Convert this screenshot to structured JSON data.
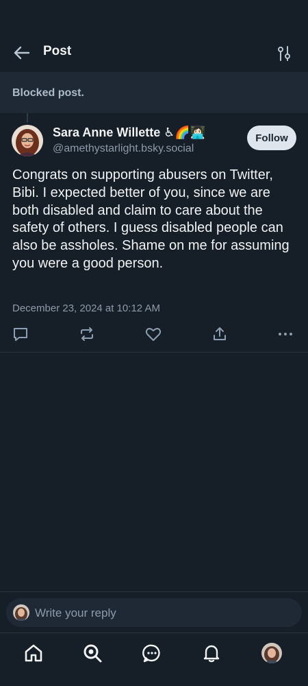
{
  "header": {
    "title": "Post"
  },
  "blocked": {
    "text": "Blocked post."
  },
  "post": {
    "author_name": "Sara Anne Willette ♿🌈👩🏻‍💻",
    "author_handle": "@amethystarlight.bsky.social",
    "follow_label": "Follow",
    "text": "Congrats on supporting abusers on Twitter, Bibi. I expected better of you, since we are both disabled and claim to care about the safety of others. I guess disabled people can also be assholes. Shame on me for assuming you were a good person.",
    "date": "December 23, 2024 at 10:12 AM"
  },
  "actions": {
    "icons": [
      "reply-icon",
      "repost-icon",
      "like-icon",
      "share-icon",
      "more-icon"
    ]
  },
  "reply": {
    "placeholder": "Write your reply"
  },
  "tabbar": {
    "icons": [
      "home-icon",
      "search-icon",
      "chat-icon",
      "notifications-icon",
      "profile-avatar"
    ]
  },
  "colors": {
    "background": "#161e27",
    "blocked_bg": "#1e2935",
    "text": "#f1f3f5",
    "muted": "#8c9aaa",
    "follow_bg": "#dfe5ec"
  }
}
